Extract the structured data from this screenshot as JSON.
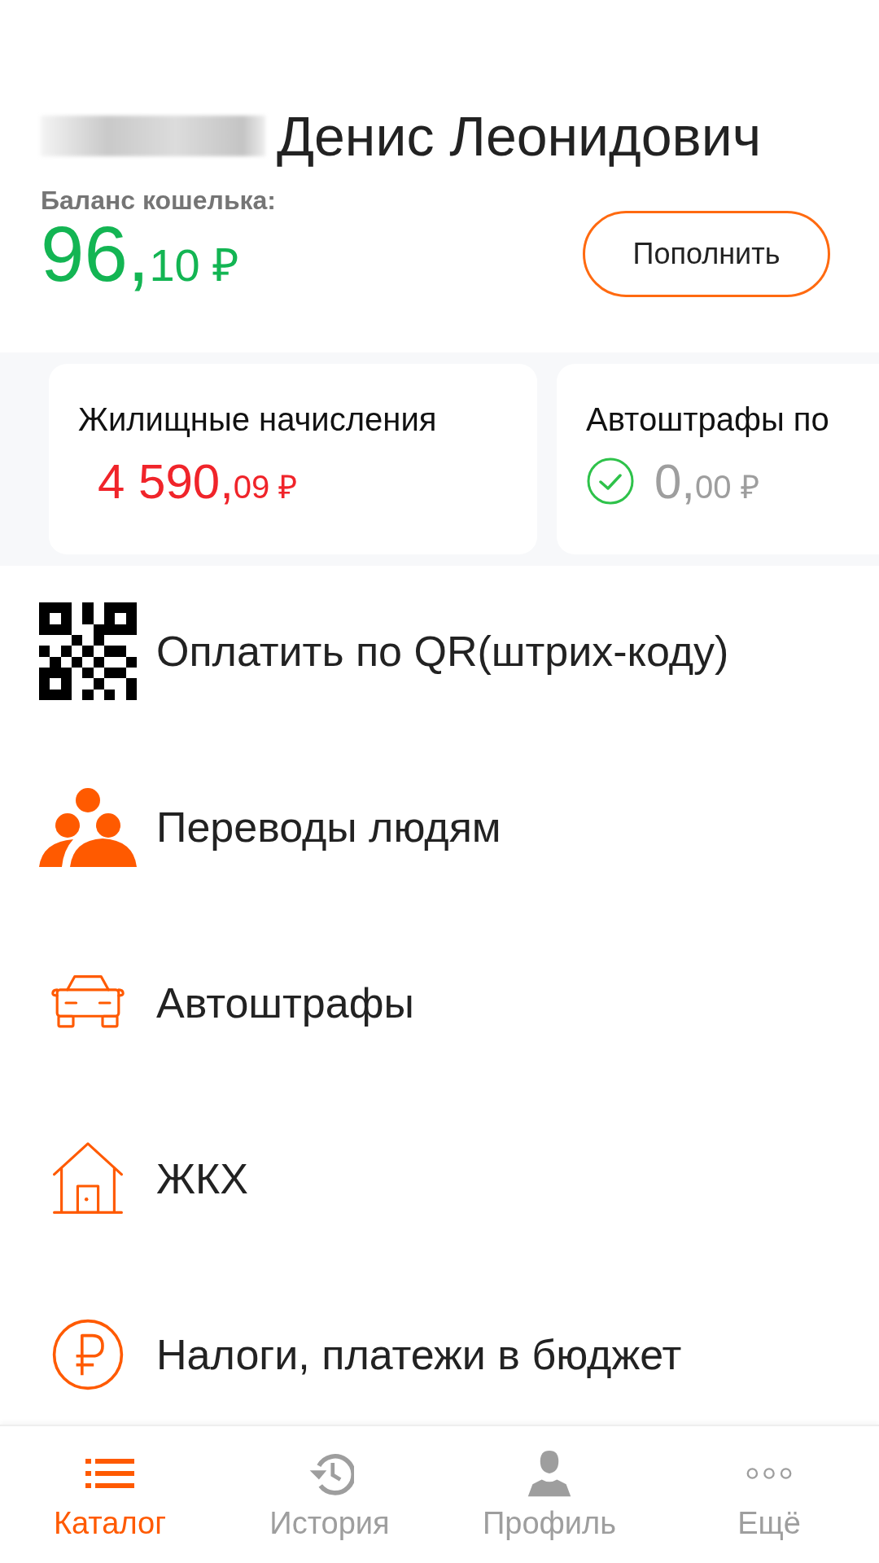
{
  "header": {
    "name": "Денис Леонидович",
    "balance_label": "Баланс кошелька:",
    "balance": {
      "main": "96,",
      "fraction": "10 ₽"
    },
    "top_up_button": "Пополнить"
  },
  "cards": [
    {
      "title": "Жилищные начисления",
      "kind": "due",
      "amount": {
        "main": "4 590,",
        "fraction": "09 ₽"
      }
    },
    {
      "title": "Автоштрафы по",
      "kind": "paid",
      "amount": {
        "main": "0,",
        "fraction": "00 ₽"
      }
    }
  ],
  "menu": [
    {
      "kind": "qr",
      "label": "Оплатить по QR(штрих-коду)"
    },
    {
      "kind": "people",
      "label": "Переводы людям"
    },
    {
      "kind": "car",
      "label": "Автоштрафы"
    },
    {
      "kind": "house",
      "label": "ЖКХ"
    },
    {
      "kind": "ruble",
      "label": "Налоги, платежи в бюджет"
    }
  ],
  "bottom_nav": [
    {
      "kind": "catalog",
      "label": "Каталог",
      "selected": true
    },
    {
      "kind": "history",
      "label": "История",
      "selected": false
    },
    {
      "kind": "profile",
      "label": "Профиль",
      "selected": false
    },
    {
      "kind": "more",
      "label": "Ещё",
      "selected": false
    }
  ]
}
